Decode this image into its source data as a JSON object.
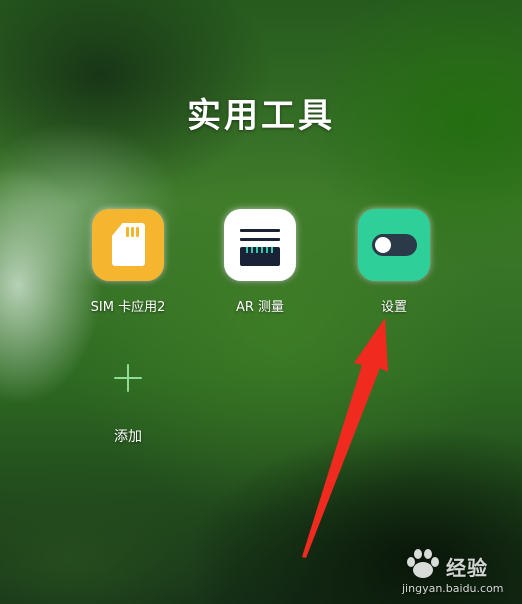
{
  "folder": {
    "title": "实用工具"
  },
  "apps": [
    {
      "label": "SIM 卡应用2",
      "icon": "sim-card-icon",
      "color": "#f5b52e"
    },
    {
      "label": "AR 测量",
      "icon": "ruler-icon",
      "color": "#ffffff"
    },
    {
      "label": "设置",
      "icon": "toggle-switch-icon",
      "color": "#2ecf98"
    }
  ],
  "add_button": {
    "label": "添加",
    "icon": "plus-icon",
    "color": "#8edc97"
  },
  "annotation": {
    "icon": "red-arrow-icon",
    "color": "#f02a1e"
  },
  "watermark": {
    "name": "经验",
    "url": "jingyan.baidu.com",
    "logo": "paw-logo-icon"
  }
}
